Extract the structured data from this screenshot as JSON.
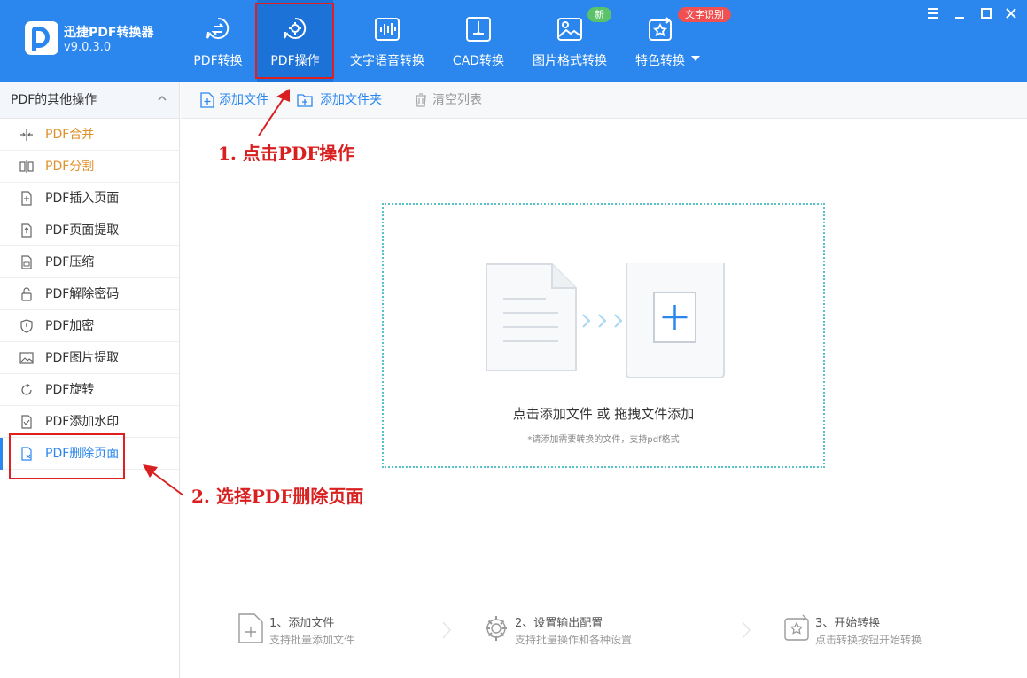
{
  "app": {
    "name": "迅捷PDF转换器",
    "version": "v9.0.3.0"
  },
  "tabs": [
    {
      "label": "PDF转换",
      "icon": "pdf-convert-icon"
    },
    {
      "label": "PDF操作",
      "icon": "pdf-operate-icon"
    },
    {
      "label": "文字语音转换",
      "icon": "voice-icon"
    },
    {
      "label": "CAD转换",
      "icon": "cad-icon"
    },
    {
      "label": "图片格式转换",
      "icon": "image-icon"
    },
    {
      "label": "特色转换",
      "icon": "special-convert-icon"
    }
  ],
  "badges": {
    "new": "新",
    "ocr": "文字识别"
  },
  "sidebar": {
    "title": "PDF的其他操作",
    "items": [
      {
        "label": "PDF合并"
      },
      {
        "label": "PDF分割"
      },
      {
        "label": "PDF插入页面"
      },
      {
        "label": "PDF页面提取"
      },
      {
        "label": "PDF压缩"
      },
      {
        "label": "PDF解除密码"
      },
      {
        "label": "PDF加密"
      },
      {
        "label": "PDF图片提取"
      },
      {
        "label": "PDF旋转"
      },
      {
        "label": "PDF添加水印"
      },
      {
        "label": "PDF删除页面"
      }
    ]
  },
  "toolbar": {
    "add_file": "添加文件",
    "add_folder": "添加文件夹",
    "clear_list": "清空列表"
  },
  "dropzone": {
    "text": "点击添加文件 或 拖拽文件添加",
    "hint": "*请添加需要转换的文件，支持pdf格式"
  },
  "annotations": {
    "step1": "1. 点击PDF操作",
    "step2": "2. 选择PDF删除页面"
  },
  "steps": [
    {
      "title": "1、添加文件",
      "desc": "支持批量添加文件"
    },
    {
      "title": "2、设置输出配置",
      "desc": "支持批量操作和各种设置"
    },
    {
      "title": "3、开始转换",
      "desc": "点击转换按钮开始转换"
    }
  ],
  "colors": {
    "header": "#2b87ee",
    "active_tab": "#1d72d8",
    "annotation": "#e02020",
    "dropzone_border": "#58c1c9",
    "orange_text": "#e0912a"
  }
}
